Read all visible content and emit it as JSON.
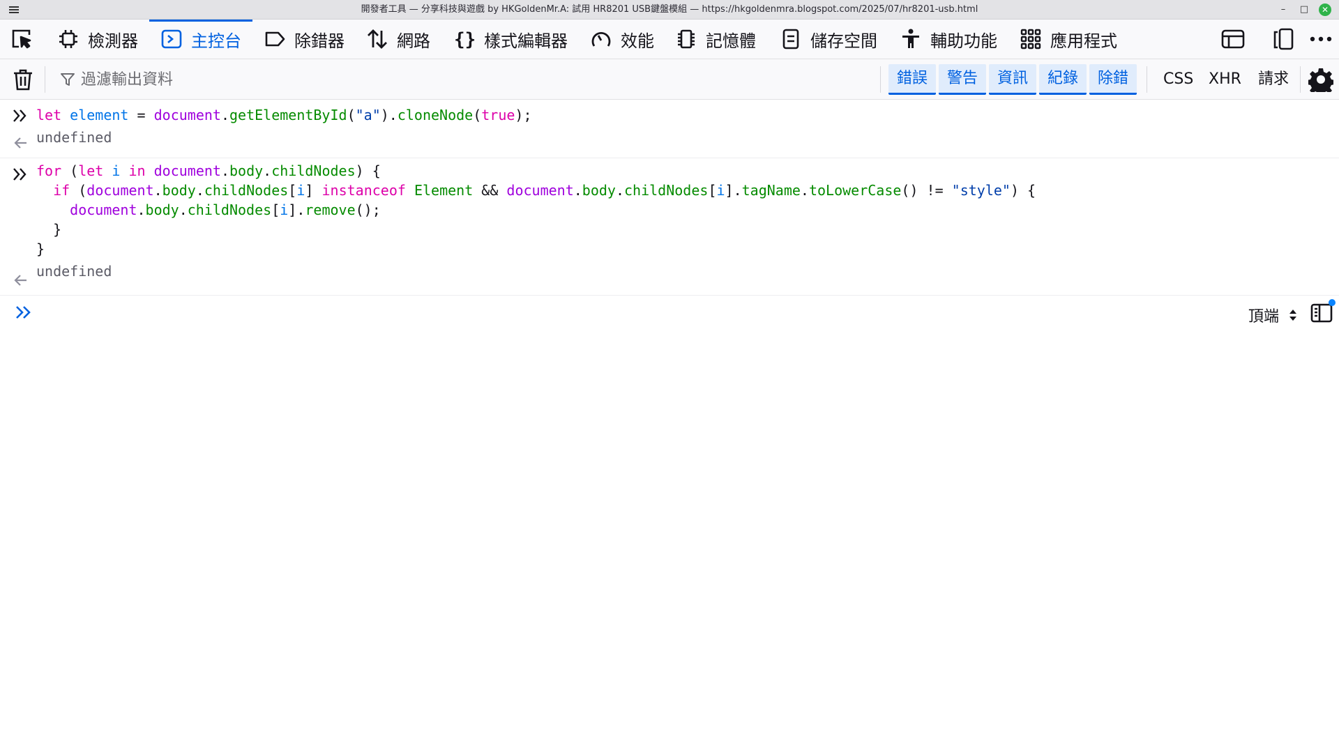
{
  "window": {
    "title": "開發者工具 — 分享科技與遊戲 by HKGoldenMr.A: 試用 HR8201 USB鍵盤模組 — https://hkgoldenmra.blogspot.com/2025/07/hr8201-usb.html",
    "minimize": "–",
    "maximize": "□",
    "close": "✕"
  },
  "tabs": [
    {
      "label": "檢測器",
      "icon": "inspector-icon"
    },
    {
      "label": "主控台",
      "icon": "console-icon",
      "active": true
    },
    {
      "label": "除錯器",
      "icon": "debugger-icon"
    },
    {
      "label": "網路",
      "icon": "network-icon"
    },
    {
      "label": "樣式編輯器",
      "icon": "style-editor-icon"
    },
    {
      "label": "效能",
      "icon": "performance-icon"
    },
    {
      "label": "記憶體",
      "icon": "memory-icon"
    },
    {
      "label": "儲存空間",
      "icon": "storage-icon"
    },
    {
      "label": "輔助功能",
      "icon": "accessibility-icon"
    },
    {
      "label": "應用程式",
      "icon": "application-icon"
    }
  ],
  "filter": {
    "placeholder": "過濾輸出資料",
    "levels": [
      "錯誤",
      "警告",
      "資訊",
      "紀錄",
      "除錯"
    ],
    "extras": [
      "CSS",
      "XHR",
      "請求"
    ]
  },
  "console": {
    "result_text": "undefined",
    "context_selector": "頂端"
  },
  "colors": {
    "accent": "#0061e0",
    "keyword": "#dd00a9",
    "variable": "#0074e8",
    "property": "#058b00",
    "object": "#9f00dd",
    "string": "#003eaa"
  }
}
